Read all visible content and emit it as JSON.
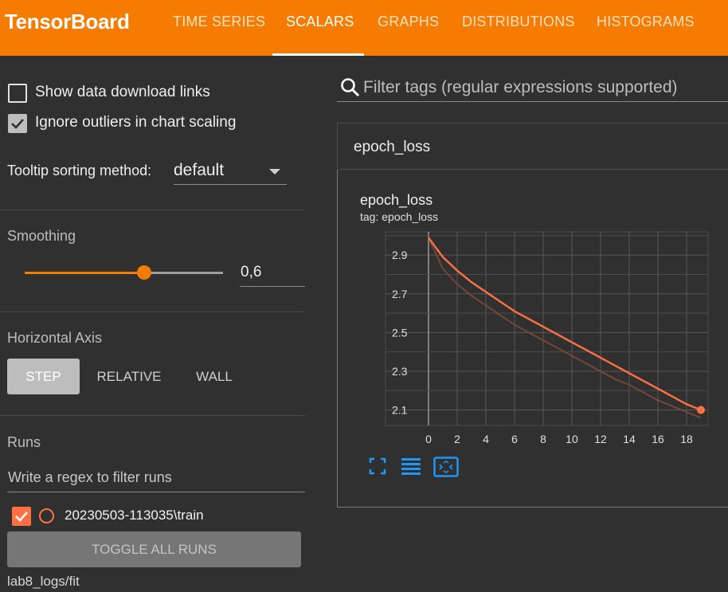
{
  "app": {
    "title": "TensorBoard",
    "tabs": [
      {
        "label": "TIME SERIES",
        "active": false
      },
      {
        "label": "SCALARS",
        "active": true
      },
      {
        "label": "GRAPHS",
        "active": false
      },
      {
        "label": "DISTRIBUTIONS",
        "active": false
      },
      {
        "label": "HISTOGRAMS",
        "active": false
      }
    ],
    "accent_color": "#f57c00"
  },
  "sidebar": {
    "show_download_links": {
      "label": "Show data download links",
      "checked": false
    },
    "ignore_outliers": {
      "label": "Ignore outliers in chart scaling",
      "checked": true
    },
    "tooltip_sorting": {
      "label": "Tooltip sorting method:",
      "value": "default"
    },
    "smoothing": {
      "title": "Smoothing",
      "value": "0,6",
      "level": 0.6
    },
    "horizontal_axis": {
      "title": "Horizontal Axis",
      "options": [
        "STEP",
        "RELATIVE",
        "WALL"
      ],
      "selected": "STEP"
    },
    "runs": {
      "title": "Runs",
      "filter_placeholder": "Write a regex to filter runs",
      "items": [
        {
          "name": "20230503-113035\\train",
          "checked": true,
          "color": "#ff7043"
        }
      ],
      "toggle_label": "TOGGLE ALL RUNS",
      "logdir": "lab8_logs/fit"
    }
  },
  "main": {
    "filter_placeholder": "Filter tags (regular expressions supported)",
    "group": "epoch_loss",
    "card": {
      "title": "epoch_loss",
      "tag": "tag: epoch_loss"
    },
    "tools": [
      "fit-domain-icon",
      "toggle-log-scale-icon",
      "fit-data-icon"
    ]
  },
  "chart_data": {
    "type": "line",
    "xlim": [
      -3,
      19.5
    ],
    "ylim": [
      2.02,
      3.02
    ],
    "x_ticks": [
      "0",
      "2",
      "4",
      "6",
      "8",
      "10",
      "12",
      "14",
      "16",
      "18"
    ],
    "y_ticks": [
      "2.1",
      "2.3",
      "2.5",
      "2.7",
      "2.9"
    ],
    "grid": true,
    "series": [
      {
        "style": "smoothed",
        "color": "#ff7043",
        "x": [
          0,
          1,
          2,
          3,
          4,
          5,
          6,
          7,
          8,
          9,
          10,
          11,
          12,
          13,
          14,
          15,
          16,
          17,
          18,
          19
        ],
        "y": [
          2.99,
          2.89,
          2.82,
          2.76,
          2.71,
          2.66,
          2.61,
          2.57,
          2.53,
          2.49,
          2.45,
          2.41,
          2.37,
          2.33,
          2.29,
          2.25,
          2.21,
          2.17,
          2.13,
          2.1
        ]
      },
      {
        "style": "raw",
        "color": "#7a4a3c",
        "x": [
          0,
          1,
          2,
          3,
          4,
          5,
          6,
          7,
          8,
          9,
          10,
          11,
          12,
          13,
          14,
          15,
          16,
          17,
          18,
          19
        ],
        "y": [
          2.99,
          2.83,
          2.75,
          2.69,
          2.64,
          2.59,
          2.54,
          2.5,
          2.46,
          2.42,
          2.38,
          2.34,
          2.3,
          2.26,
          2.23,
          2.19,
          2.15,
          2.12,
          2.09,
          2.06
        ]
      }
    ]
  }
}
